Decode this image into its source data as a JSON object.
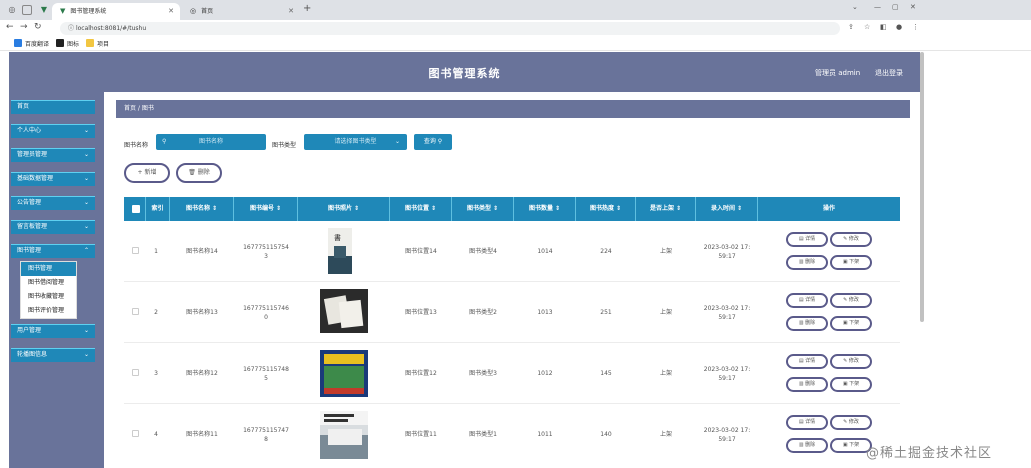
{
  "browser": {
    "tabs": [
      {
        "title": "图书管理系统",
        "active": true
      },
      {
        "title": "首页",
        "active": false
      }
    ],
    "url": "localhost:8081/#/tushu",
    "bookmarks": [
      "百度翻译",
      "图标",
      "项目"
    ]
  },
  "header": {
    "title": "图书管理系统",
    "user": "管理员 admin",
    "logout": "退出登录"
  },
  "sidebar": {
    "items": [
      {
        "label": "首页",
        "chevron": false
      },
      {
        "label": "个人中心",
        "chevron": true
      },
      {
        "label": "管理员管理",
        "chevron": true
      },
      {
        "label": "基础数据管理",
        "chevron": true
      },
      {
        "label": "公告管理",
        "chevron": true
      },
      {
        "label": "留言板管理",
        "chevron": true
      },
      {
        "label": "图书管理",
        "chevron": true
      }
    ],
    "submenu": [
      "图书管理",
      "图书借阅管理",
      "图书收藏管理",
      "图书评价管理"
    ],
    "items_after": [
      {
        "label": "用户管理",
        "chevron": true
      },
      {
        "label": "轮播图信息",
        "chevron": true
      }
    ]
  },
  "breadcrumb": "首页 / 图书",
  "search": {
    "name_label": "图书名称",
    "name_placeholder": "图书名称",
    "type_label": "图书类型",
    "type_placeholder": "请选择图书类型",
    "query_button": "查询"
  },
  "actions": {
    "add": "+ 新增",
    "delete": "删除"
  },
  "table": {
    "columns": [
      "索引",
      "图书名称 ⇕",
      "图书编号 ⇕",
      "图书照片 ⇕",
      "图书位置 ⇕",
      "图书类型 ⇕",
      "图书数量 ⇕",
      "图书热度 ⇕",
      "是否上架 ⇕",
      "录入时间 ⇕",
      "操作"
    ],
    "rows": [
      {
        "index": "1",
        "name": "图书名称14",
        "code1": "167775115754",
        "code2": "3",
        "location": "图书位置14",
        "type": "图书类型4",
        "qty": "1014",
        "heat": "224",
        "shelf": "上架",
        "date": "2023-03-02 17:",
        "time": "59:17"
      },
      {
        "index": "2",
        "name": "图书名称13",
        "code1": "167775115746",
        "code2": "0",
        "location": "图书位置13",
        "type": "图书类型2",
        "qty": "1013",
        "heat": "251",
        "shelf": "上架",
        "date": "2023-03-02 17:",
        "time": "59:17"
      },
      {
        "index": "3",
        "name": "图书名称12",
        "code1": "167775115748",
        "code2": "5",
        "location": "图书位置12",
        "type": "图书类型3",
        "qty": "1012",
        "heat": "145",
        "shelf": "上架",
        "date": "2023-03-02 17:",
        "time": "59:17"
      },
      {
        "index": "4",
        "name": "图书名称11",
        "code1": "167775115747",
        "code2": "8",
        "location": "图书位置11",
        "type": "图书类型1",
        "qty": "1011",
        "heat": "140",
        "shelf": "上架",
        "date": "2023-03-02 17:",
        "time": "59:17"
      }
    ],
    "row_actions": {
      "detail": "详情",
      "edit": "修改",
      "delete": "删除",
      "unshelf": "下架"
    }
  },
  "watermark": "@稀土掘金技术社区",
  "colors": {
    "header": "#69739a",
    "accent": "#1f88b8",
    "pill_border": "#5a5a8a"
  }
}
